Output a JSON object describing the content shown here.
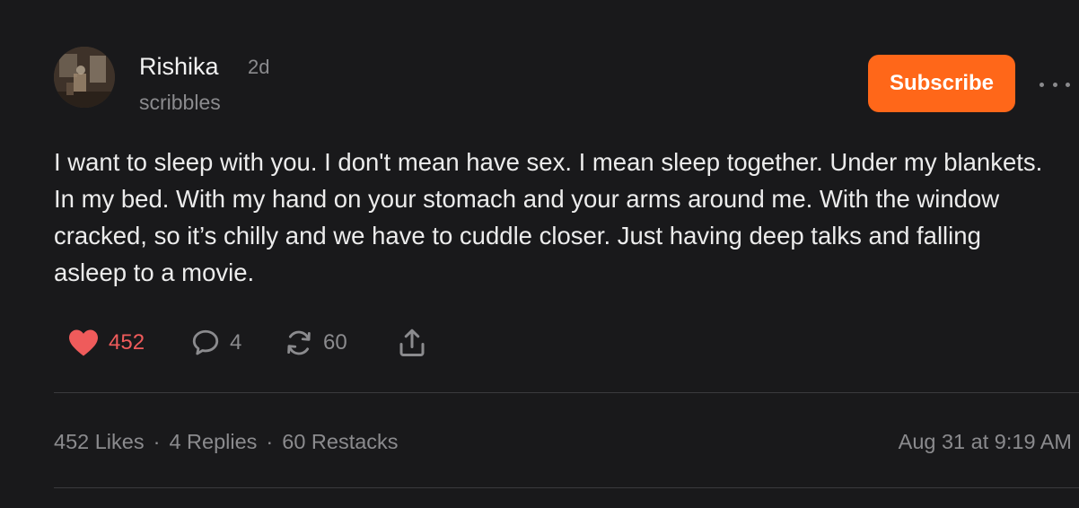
{
  "author": {
    "name": "Rishika",
    "age": "2d",
    "publication": "scribbles"
  },
  "subscribe_label": "Subscribe",
  "post": {
    "text": "I want to sleep with you. I don't mean have sex. I mean sleep together. Under my blankets. In my bed. With my hand on your stomach and your arms around me. With the window cracked, so it’s chilly and we have to cuddle closer. Just having deep talks and falling asleep to a movie."
  },
  "actions": {
    "likes": "452",
    "replies": "4",
    "restacks": "60"
  },
  "stats": {
    "likes": "452 Likes",
    "replies": "4 Replies",
    "restacks": "60 Restacks",
    "separator": "·",
    "timestamp": "Aug 31 at 9:19 AM"
  },
  "icons": {
    "like": "heart-icon",
    "reply": "comment-bubble-icon",
    "restack": "restack-icon",
    "share": "share-icon",
    "more": "more-dots-icon"
  },
  "colors": {
    "background": "#19191b",
    "accent": "#ff6719",
    "like": "#ef5b5b",
    "muted": "#8b8b8e"
  }
}
